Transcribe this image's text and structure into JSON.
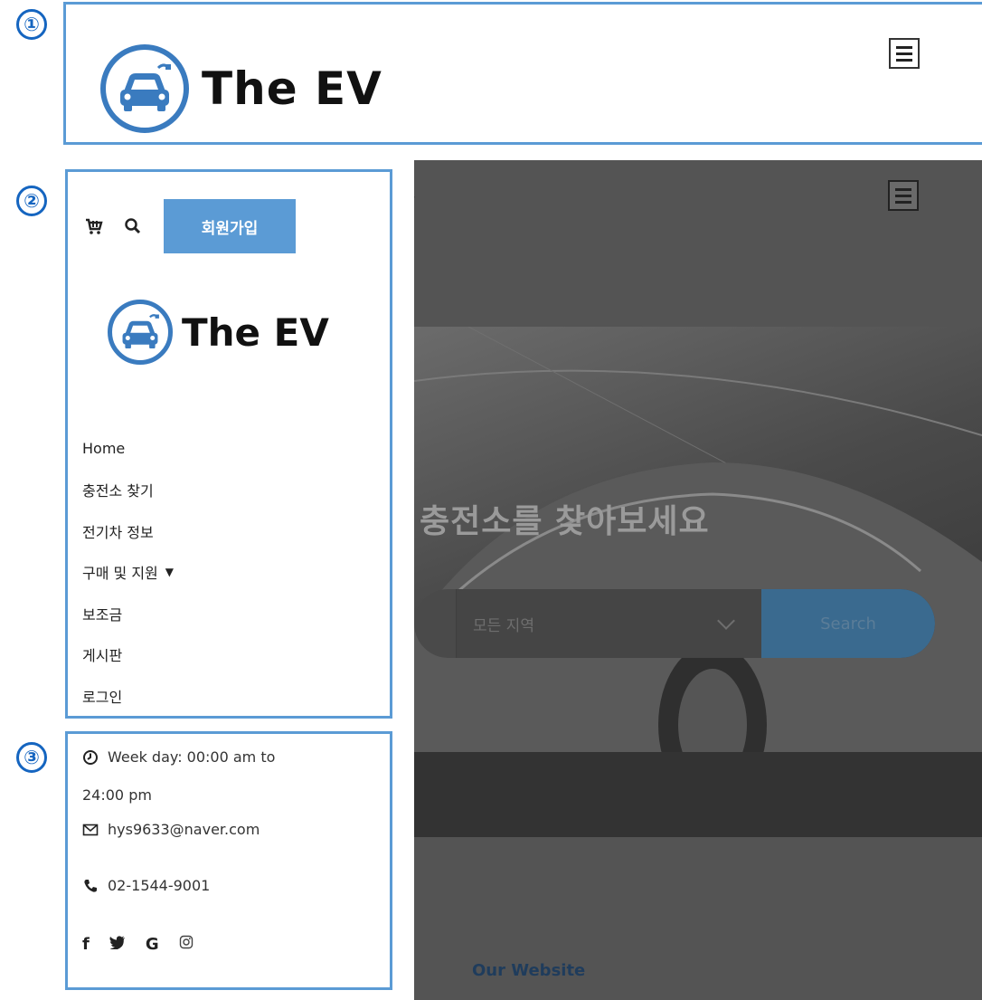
{
  "badges": {
    "one": "①",
    "two": "②",
    "three": "③"
  },
  "brand": {
    "name": "The EV",
    "accent": "#5b9bd5",
    "ring_color": "#3a7bbf"
  },
  "header": {
    "menu_icon": "hamburger-menu-icon"
  },
  "sidebar": {
    "signup_label": "회원가입",
    "icons": [
      "cart-icon",
      "search-icon"
    ],
    "nav": [
      {
        "label": "Home"
      },
      {
        "label": "충전소 찾기"
      },
      {
        "label": "전기차 정보"
      },
      {
        "label": "구매 및 지원",
        "has_dropdown": true,
        "arrow": "▼"
      },
      {
        "label": "보조금"
      },
      {
        "label": "게시판"
      },
      {
        "label": "로그인"
      }
    ]
  },
  "info": {
    "hours_line1": "Week day: 00:00 am to",
    "hours_line2": "24:00 pm",
    "email": "hys9633@naver.com",
    "phone": "02-1544-9001",
    "social": [
      "f",
      "G"
    ],
    "social_icons": [
      "facebook-icon",
      "twitter-icon",
      "google-icon",
      "instagram-icon"
    ]
  },
  "hero": {
    "title": "충전소를 찾아보세요",
    "region_placeholder": "모든 지역",
    "search_label": "Search",
    "footer_heading": "Our Website"
  }
}
